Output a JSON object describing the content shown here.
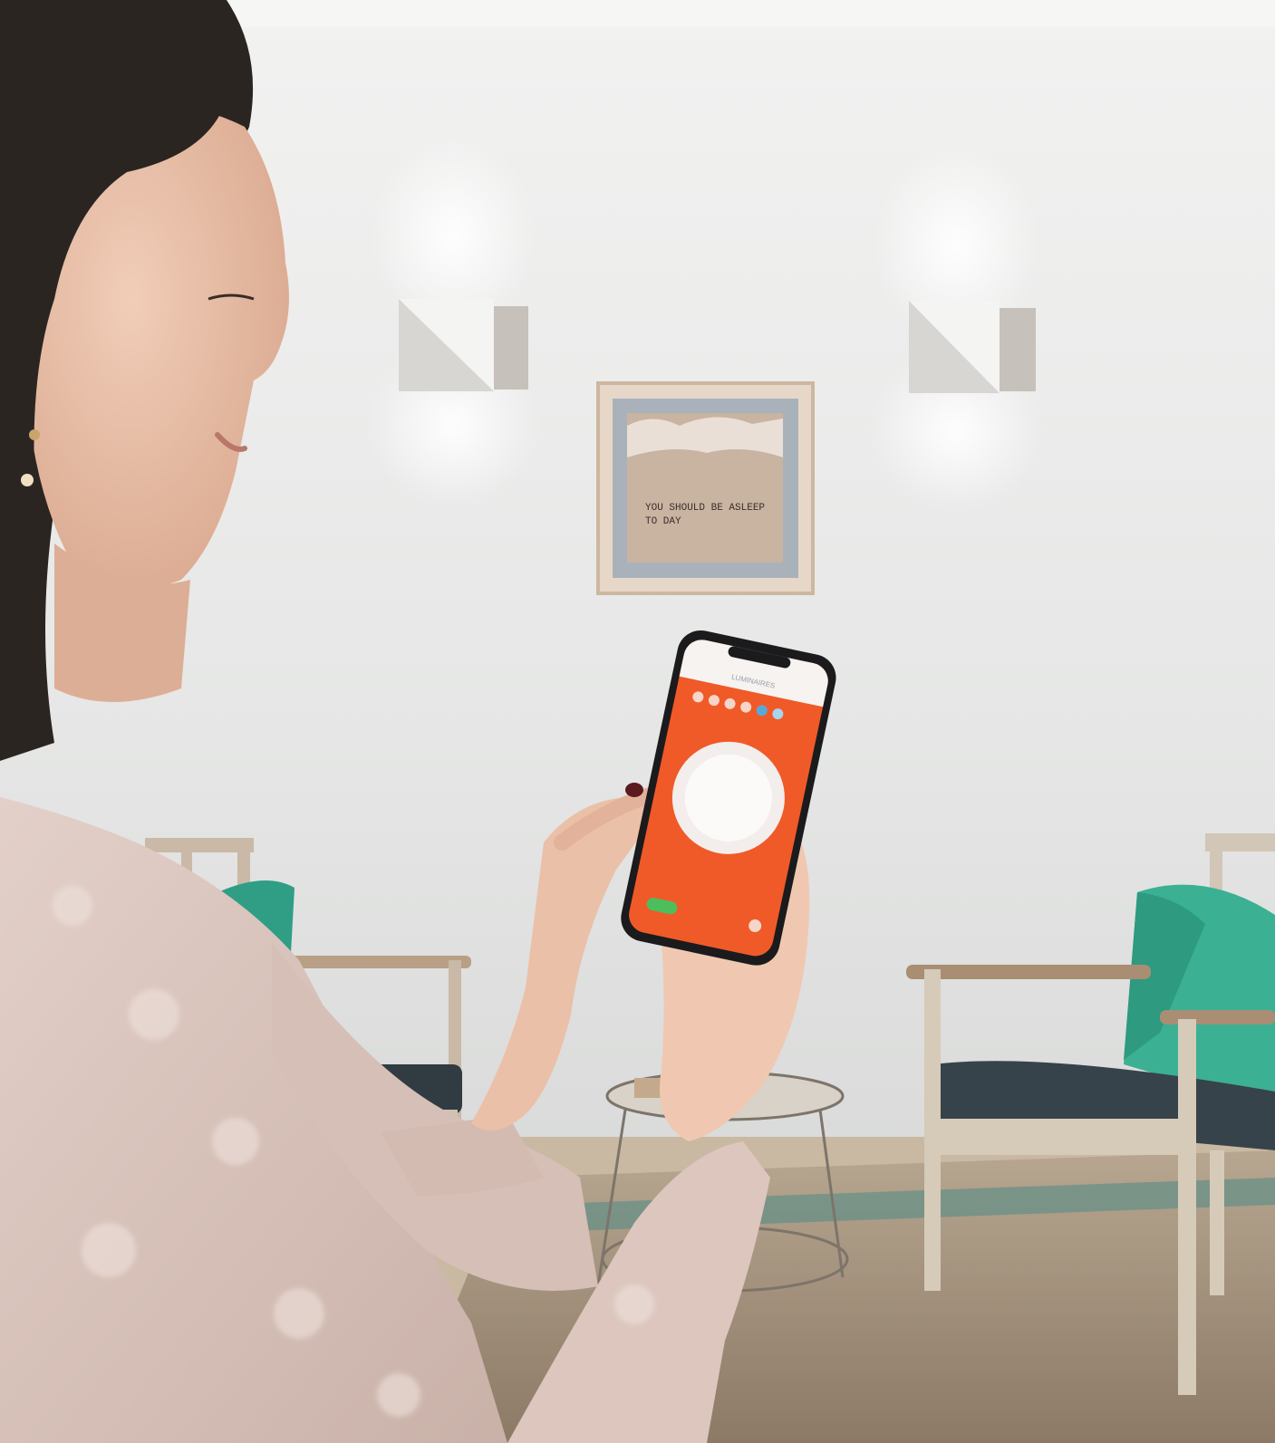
{
  "scene": {
    "alt": "Woman using a smartphone app to control wall lights in a living room",
    "colors": {
      "wall": "#ecedec",
      "floor_rug": "#a38f78",
      "app_accent": "#f05a28",
      "cushion": "#3bb092",
      "seat": "#37434a",
      "sweater": "#d9c3bb",
      "hair": "#2b2522"
    }
  },
  "artwork": {
    "line1": "YOU SHOULD BE ASLEEP",
    "line2": "TO DAY"
  },
  "phone_app": {
    "header_title": "LUMINAIRES",
    "scene_dots": 6,
    "dimmer_icon": "power-dial-icon",
    "bottom_left_icon": "toggle-on-icon",
    "bottom_right_icon": "settings-icon"
  },
  "icons": {
    "wall_light_left": "wall-sconce-icon",
    "wall_light_right": "wall-sconce-icon"
  }
}
